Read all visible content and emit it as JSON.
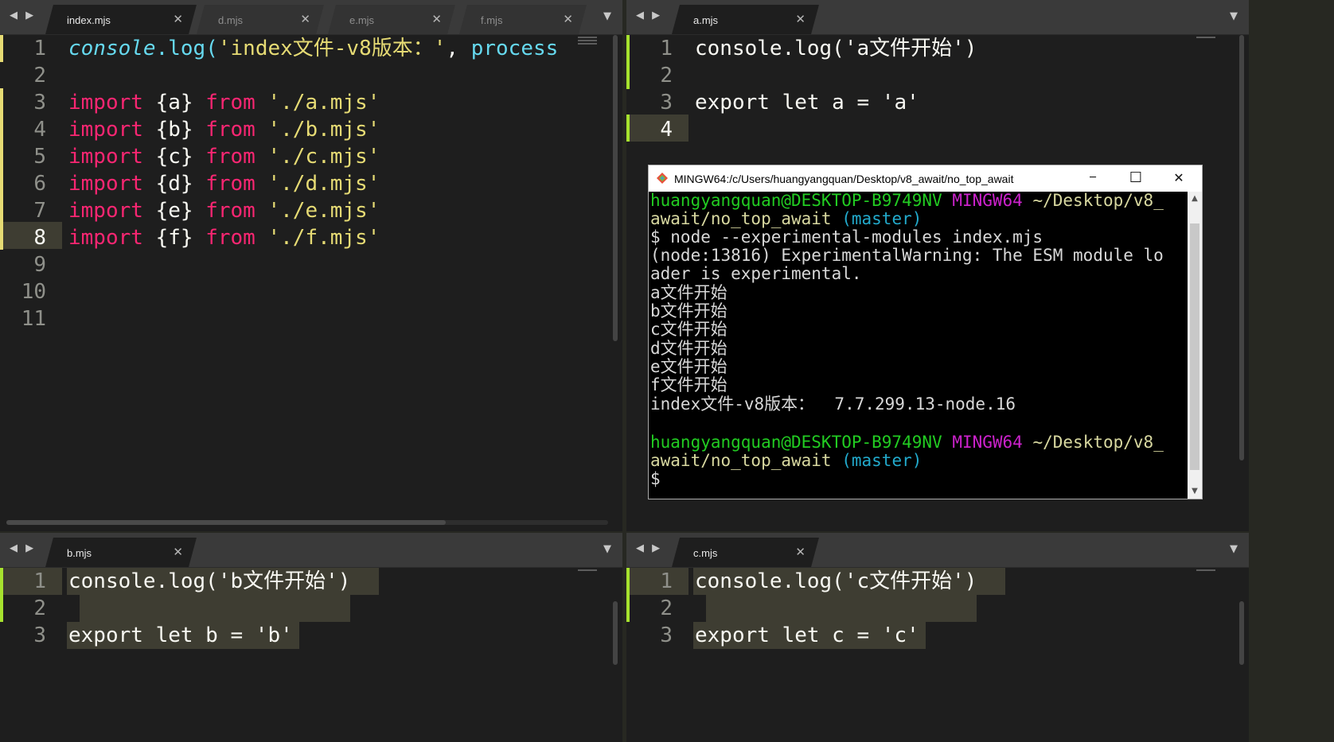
{
  "panes": {
    "top_left": {
      "tabs": [
        {
          "label": "index.mjs",
          "active": true
        },
        {
          "label": "d.mjs",
          "active": false
        },
        {
          "label": "e.mjs",
          "active": false
        },
        {
          "label": "f.mjs",
          "active": false
        }
      ],
      "line_numbers": [
        "1",
        "2",
        "3",
        "4",
        "5",
        "6",
        "7",
        "8",
        "9",
        "10",
        "11"
      ],
      "code": {
        "l1_a": "console",
        "l1_b": ".log(",
        "l1_c": "'index文件-v8版本：'",
        "l1_d": ", ",
        "l1_e": "process",
        "imports": [
          {
            "kw": "import",
            "names": " {a} ",
            "from": "from",
            "path": " './a.mjs'"
          },
          {
            "kw": "import",
            "names": " {b} ",
            "from": "from",
            "path": " './b.mjs'"
          },
          {
            "kw": "import",
            "names": " {c} ",
            "from": "from",
            "path": " './c.mjs'"
          },
          {
            "kw": "import",
            "names": " {d} ",
            "from": "from",
            "path": " './d.mjs'"
          },
          {
            "kw": "import",
            "names": " {e} ",
            "from": "from",
            "path": " './e.mjs'"
          },
          {
            "kw": "import",
            "names": " {f} ",
            "from": "from",
            "path": " './f.mjs'"
          }
        ]
      }
    },
    "top_right": {
      "tabs": [
        {
          "label": "a.mjs",
          "active": true
        }
      ],
      "line_numbers": [
        "1",
        "2",
        "3",
        "4"
      ],
      "code": {
        "l1": "console.log('a文件开始')",
        "l3": "export let a = 'a'"
      }
    },
    "bottom_left": {
      "tabs": [
        {
          "label": "b.mjs",
          "active": true
        }
      ],
      "line_numbers": [
        "1",
        "2",
        "3"
      ],
      "code": {
        "l1": "console.log('b文件开始')",
        "l3": "export let b = 'b'"
      }
    },
    "bottom_right": {
      "tabs": [
        {
          "label": "c.mjs",
          "active": true
        }
      ],
      "line_numbers": [
        "1",
        "2",
        "3"
      ],
      "code": {
        "l1": "console.log('c文件开始')",
        "l3": "export let c = 'c'"
      }
    }
  },
  "terminal": {
    "title": "MINGW64:/c/Users/huangyangquan/Desktop/v8_await/no_top_await",
    "buttons": {
      "minimize": "─",
      "maximize": "☐",
      "close": "✕"
    },
    "prompt1": {
      "user": "huangyangquan@DESKTOP-B9749NV",
      "sys": "MINGW64",
      "path1": "~/Desktop/v8_",
      "path2": "await/no_top_await",
      "branch": "(master)"
    },
    "command": "$ node --experimental-modules index.mjs",
    "warning1": "(node:13816) ExperimentalWarning: The ESM module lo",
    "warning2": "ader is experimental.",
    "outputs": [
      "a文件开始",
      "b文件开始",
      "c文件开始",
      "d文件开始",
      "e文件开始",
      "f文件开始"
    ],
    "version_line": "index文件-v8版本：  7.7.299.13-node.16",
    "prompt2": {
      "user": "huangyangquan@DESKTOP-B9749NV",
      "sys": "MINGW64",
      "path1": "~/Desktop/v8_",
      "path2": "await/no_top_await",
      "branch": "(master)"
    },
    "cursor_prompt": "$"
  },
  "colors": {
    "keyword": "#f92672",
    "string": "#e6db74",
    "function": "#66d9ef",
    "term_green": "#22cc22",
    "term_magenta": "#cc22cc",
    "term_cyan": "#22aacc"
  }
}
